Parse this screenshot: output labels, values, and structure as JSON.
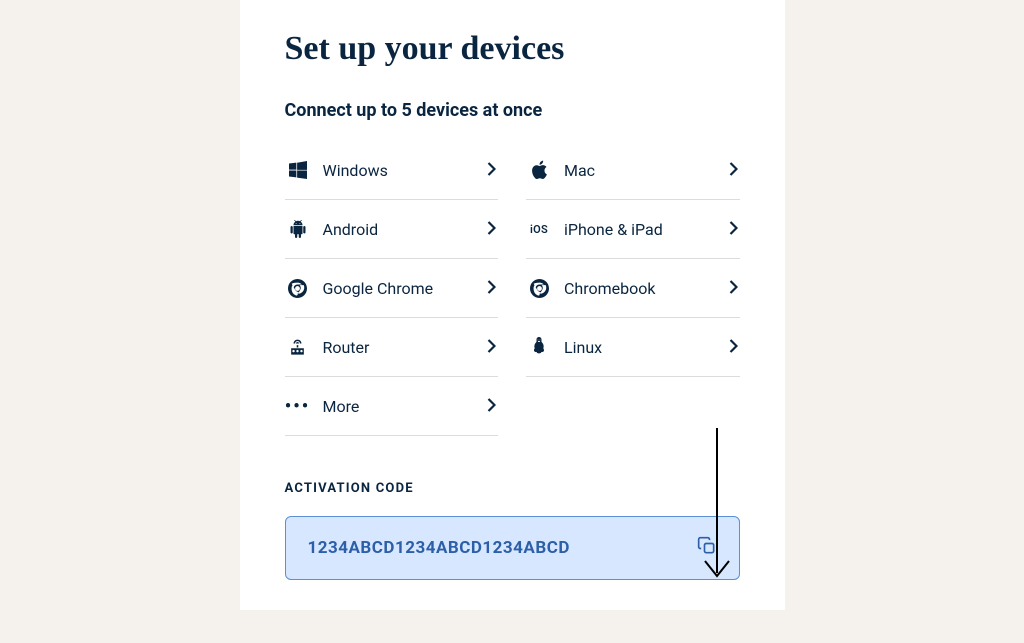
{
  "title": "Set up your devices",
  "subtitle": "Connect up to 5 devices at once",
  "devices": [
    {
      "label": "Windows",
      "icon": "windows"
    },
    {
      "label": "Mac",
      "icon": "apple"
    },
    {
      "label": "Android",
      "icon": "android"
    },
    {
      "label": "iPhone & iPad",
      "icon": "ios"
    },
    {
      "label": "Google Chrome",
      "icon": "chrome"
    },
    {
      "label": "Chromebook",
      "icon": "chrome"
    },
    {
      "label": "Router",
      "icon": "router"
    },
    {
      "label": "Linux",
      "icon": "linux"
    },
    {
      "label": "More",
      "icon": "more"
    }
  ],
  "activation": {
    "label": "ACTIVATION CODE",
    "code": "1234ABCD1234ABCD1234ABCD"
  }
}
